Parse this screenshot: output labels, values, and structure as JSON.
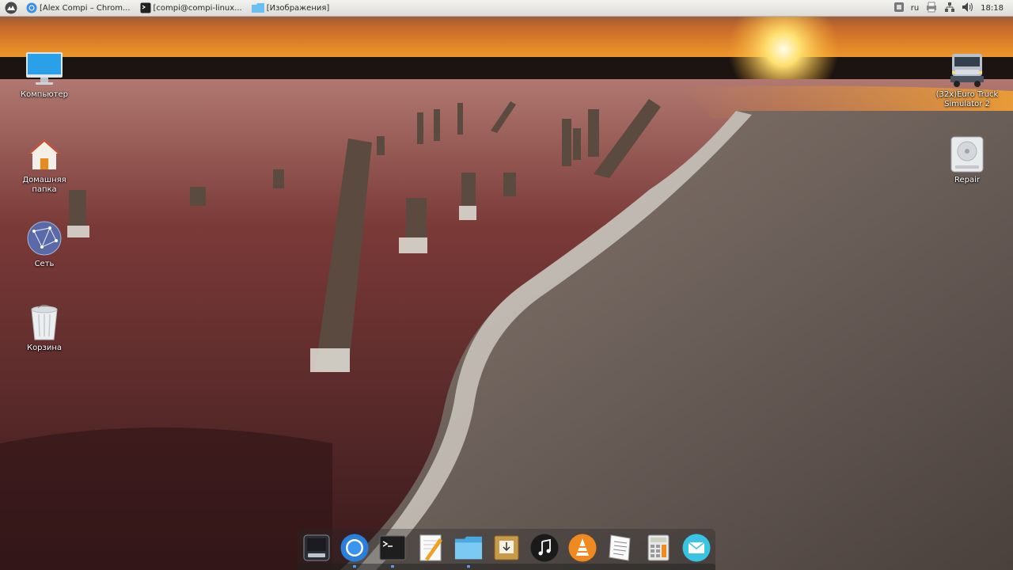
{
  "taskbar": {
    "tasks": [
      {
        "label": "[Alex Compi – Chrom...",
        "icon": "chromium-icon"
      },
      {
        "label": "[compi@compi-linux...",
        "icon": "terminal-icon"
      },
      {
        "label": "[Изображения]",
        "icon": "folder-icon"
      }
    ]
  },
  "tray": {
    "language": "ru",
    "time": "18:18"
  },
  "desktop": {
    "icons": [
      {
        "label": "Компьютер",
        "icon": "computer-icon"
      },
      {
        "label": "Домашняя\nпапка",
        "icon": "home-folder-icon"
      },
      {
        "label": "Сеть",
        "icon": "network-icon"
      },
      {
        "label": "Корзина",
        "icon": "trash-icon"
      },
      {
        "label": "(32x)Euro Truck\nSimulator 2",
        "icon": "truck-icon"
      },
      {
        "label": "Repair",
        "icon": "drive-icon"
      }
    ]
  },
  "dock": {
    "items": [
      {
        "icon": "system-monitor-icon"
      },
      {
        "icon": "chromium-icon"
      },
      {
        "icon": "terminal-icon"
      },
      {
        "icon": "text-editor-icon"
      },
      {
        "icon": "file-manager-icon"
      },
      {
        "icon": "archive-manager-icon"
      },
      {
        "icon": "music-player-icon"
      },
      {
        "icon": "vlc-icon"
      },
      {
        "icon": "document-icon"
      },
      {
        "icon": "calculator-icon"
      },
      {
        "icon": "mail-icon"
      }
    ]
  },
  "colors": {
    "accent": "#5aa0ff",
    "panel": "#e8e6e2"
  }
}
